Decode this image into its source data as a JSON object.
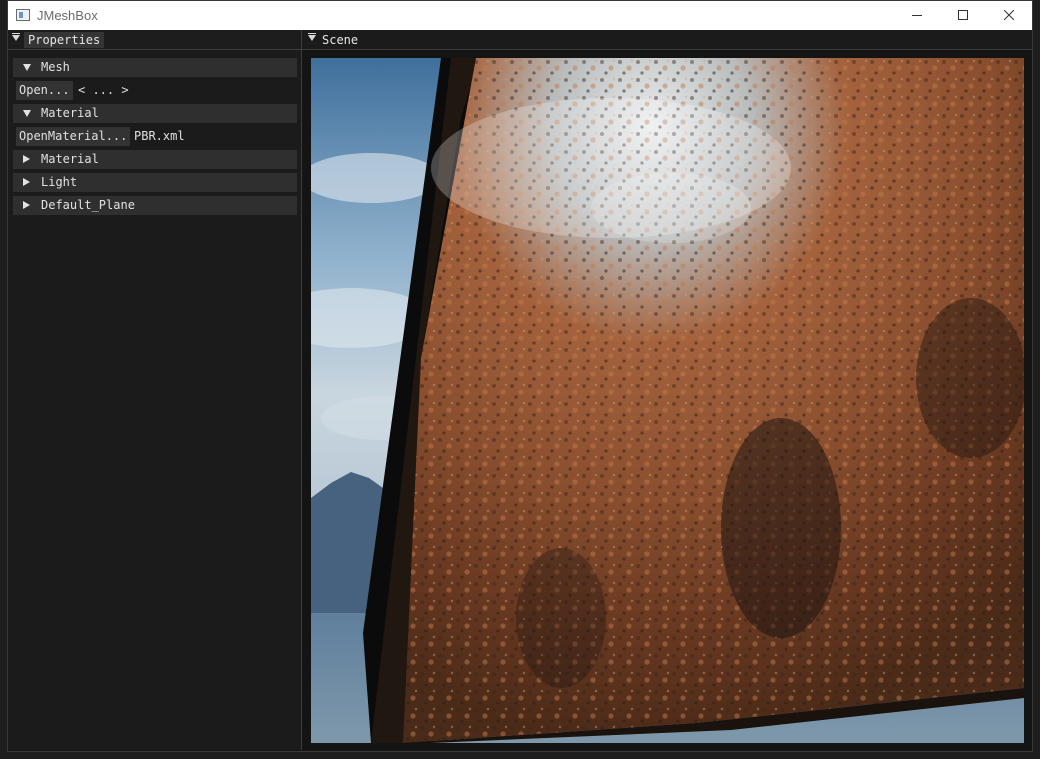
{
  "window": {
    "title": "JMeshBox"
  },
  "properties_panel": {
    "tab_label": "Properties",
    "mesh_header": "Mesh",
    "open_button": "Open...",
    "mesh_path_value": "< ... >",
    "material_header": "Material",
    "open_material_button": "OpenMaterial...",
    "material_file_value": "PBR.xml",
    "collapsed_headers": [
      "Material",
      "Light",
      "Default_Plane"
    ]
  },
  "scene_panel": {
    "tab_label": "Scene"
  },
  "colors": {
    "titlebar": "#ffffff",
    "panel_bg": "#1b1b1b",
    "header_bg": "#2f2f2f",
    "button_bg": "#333333",
    "text": "#e2e2e2"
  },
  "icons": [
    "app-icon",
    "minimize-icon",
    "maximize-icon",
    "close-icon",
    "collapse-arrow-icon",
    "expanded-triangle-icon",
    "collapsed-triangle-icon"
  ]
}
